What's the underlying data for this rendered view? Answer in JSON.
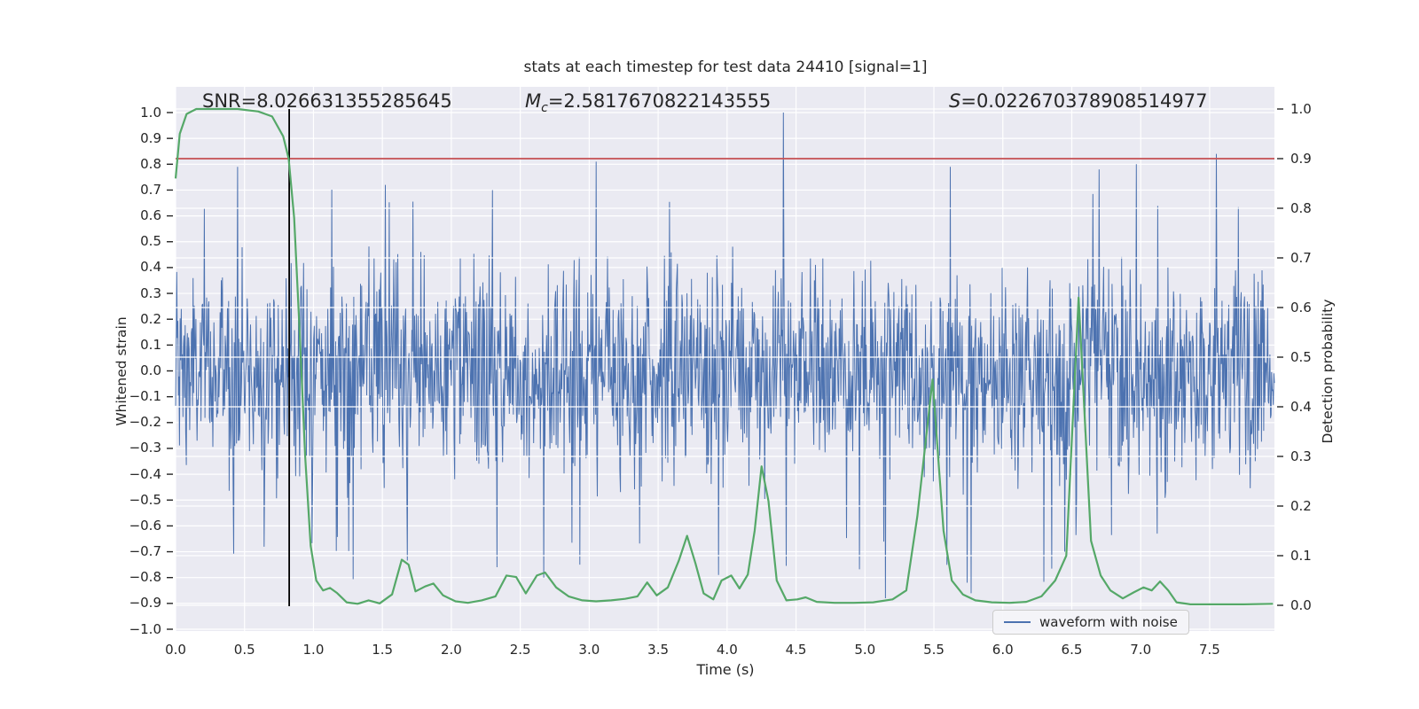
{
  "title": "stats at each timestep for test data 24410 [signal=1]",
  "annotations": {
    "snr": "SNR=8.026631355285645",
    "mc_symbol": "M",
    "mc_subscript": "c",
    "mc_value": "=2.5817670822143555",
    "s_symbol": "S",
    "s_value": "=0.022670378908514977"
  },
  "axes": {
    "x": {
      "label": "Time (s)",
      "tick_labels": [
        "0.0",
        "0.5",
        "1.0",
        "1.5",
        "2.0",
        "2.5",
        "3.0",
        "3.5",
        "4.0",
        "4.5",
        "5.0",
        "5.5",
        "6.0",
        "6.5",
        "7.0",
        "7.5"
      ],
      "tick_values": [
        0,
        0.5,
        1,
        1.5,
        2,
        2.5,
        3,
        3.5,
        4,
        4.5,
        5,
        5.5,
        6,
        6.5,
        7,
        7.5
      ],
      "range": [
        0,
        7.97
      ]
    },
    "y_left": {
      "label": "Whitened strain",
      "tick_labels": [
        "1.0",
        "0.9",
        "0.8",
        "0.7",
        "0.6",
        "0.5",
        "0.4",
        "0.3",
        "0.2",
        "0.1",
        "0.0",
        "−0.1",
        "−0.2",
        "−0.3",
        "−0.4",
        "−0.5",
        "−0.6",
        "−0.7",
        "−0.8",
        "−0.9",
        "−1.0"
      ],
      "tick_values": [
        1,
        0.9,
        0.8,
        0.7,
        0.6,
        0.5,
        0.4,
        0.3,
        0.2,
        0.1,
        0,
        -0.1,
        -0.2,
        -0.3,
        -0.4,
        -0.5,
        -0.6,
        -0.7,
        -0.8,
        -0.9,
        -1
      ],
      "range": [
        -1.0,
        1.0
      ]
    },
    "y_right": {
      "label": "Detection probability",
      "tick_labels": [
        "1.0",
        "0.9",
        "0.8",
        "0.7",
        "0.6",
        "0.5",
        "0.4",
        "0.3",
        "0.2",
        "0.1",
        "0.0"
      ],
      "tick_values": [
        1,
        0.9,
        0.8,
        0.7,
        0.6,
        0.5,
        0.4,
        0.3,
        0.2,
        0.1,
        0
      ],
      "range": [
        0.0,
        1.0
      ]
    }
  },
  "legend": {
    "label": "waveform with noise"
  },
  "colors": {
    "waveform": "#4c72b0",
    "probability": "#55a868",
    "threshold": "#c44e52",
    "event_marker": "#000000",
    "plot_bg": "#eaeaf2",
    "grid": "#ffffff",
    "text": "#262626"
  },
  "chart_data": {
    "type": "line",
    "title": "stats at each timestep for test data 24410 [signal=1]",
    "xlabel": "Time (s)",
    "ylabel_left": "Whitened strain",
    "ylabel_right": "Detection probability",
    "xlim": [
      0,
      7.97
    ],
    "ylim_left": [
      -1.0,
      1.0
    ],
    "ylim_right": [
      0.0,
      1.0
    ],
    "grid": true,
    "legend_position": "lower right",
    "threshold_line": {
      "axis": "right",
      "value": 0.9
    },
    "event_line": {
      "time": 0.824
    },
    "series": [
      {
        "name": "waveform with noise",
        "axis": "left",
        "kind": "noise",
        "samples": 1950,
        "sigma": 0.205,
        "tail_gain": 1.25,
        "clip": 1.0,
        "seed": 1234,
        "spikes": [
          {
            "t": 4.41,
            "v": 1.0
          },
          {
            "t": 3.05,
            "v": 0.81
          },
          {
            "t": 7.55,
            "v": 0.84
          },
          {
            "t": 6.97,
            "v": 0.8
          },
          {
            "t": 6.7,
            "v": 0.78
          },
          {
            "t": 5.62,
            "v": 0.79
          },
          {
            "t": 0.45,
            "v": 0.79
          },
          {
            "t": 1.52,
            "v": 0.72
          },
          {
            "t": 2.3,
            "v": 0.7
          },
          {
            "t": 2.67,
            "v": -0.8
          },
          {
            "t": 2.93,
            "v": -0.75
          },
          {
            "t": 5.15,
            "v": -0.88
          },
          {
            "t": 6.45,
            "v": -0.7
          },
          {
            "t": 7.12,
            "v": -0.63
          },
          {
            "t": 2.33,
            "v": -0.76
          },
          {
            "t": 3.94,
            "v": -0.79
          },
          {
            "t": 5.74,
            "v": -0.82
          }
        ]
      },
      {
        "name": "detection probability",
        "axis": "right",
        "kind": "line",
        "points": [
          [
            0.0,
            0.86
          ],
          [
            0.03,
            0.95
          ],
          [
            0.08,
            0.99
          ],
          [
            0.15,
            1.0
          ],
          [
            0.3,
            1.0
          ],
          [
            0.45,
            1.0
          ],
          [
            0.6,
            0.995
          ],
          [
            0.7,
            0.985
          ],
          [
            0.78,
            0.945
          ],
          [
            0.82,
            0.9
          ],
          [
            0.86,
            0.78
          ],
          [
            0.9,
            0.55
          ],
          [
            0.94,
            0.3
          ],
          [
            0.98,
            0.12
          ],
          [
            1.02,
            0.05
          ],
          [
            1.07,
            0.03
          ],
          [
            1.12,
            0.035
          ],
          [
            1.17,
            0.025
          ],
          [
            1.24,
            0.006
          ],
          [
            1.32,
            0.003
          ],
          [
            1.4,
            0.01
          ],
          [
            1.48,
            0.004
          ],
          [
            1.57,
            0.022
          ],
          [
            1.64,
            0.092
          ],
          [
            1.69,
            0.082
          ],
          [
            1.74,
            0.028
          ],
          [
            1.81,
            0.038
          ],
          [
            1.87,
            0.044
          ],
          [
            1.94,
            0.02
          ],
          [
            2.03,
            0.008
          ],
          [
            2.12,
            0.005
          ],
          [
            2.22,
            0.01
          ],
          [
            2.32,
            0.018
          ],
          [
            2.4,
            0.06
          ],
          [
            2.47,
            0.057
          ],
          [
            2.54,
            0.024
          ],
          [
            2.62,
            0.06
          ],
          [
            2.68,
            0.066
          ],
          [
            2.76,
            0.036
          ],
          [
            2.85,
            0.018
          ],
          [
            2.95,
            0.01
          ],
          [
            3.05,
            0.008
          ],
          [
            3.16,
            0.01
          ],
          [
            3.26,
            0.013
          ],
          [
            3.35,
            0.018
          ],
          [
            3.42,
            0.046
          ],
          [
            3.49,
            0.02
          ],
          [
            3.57,
            0.036
          ],
          [
            3.65,
            0.09
          ],
          [
            3.71,
            0.14
          ],
          [
            3.77,
            0.085
          ],
          [
            3.83,
            0.024
          ],
          [
            3.9,
            0.012
          ],
          [
            3.96,
            0.05
          ],
          [
            4.03,
            0.06
          ],
          [
            4.09,
            0.034
          ],
          [
            4.15,
            0.062
          ],
          [
            4.2,
            0.15
          ],
          [
            4.25,
            0.28
          ],
          [
            4.3,
            0.21
          ],
          [
            4.36,
            0.05
          ],
          [
            4.43,
            0.01
          ],
          [
            4.51,
            0.012
          ],
          [
            4.57,
            0.016
          ],
          [
            4.65,
            0.007
          ],
          [
            4.78,
            0.005
          ],
          [
            4.92,
            0.005
          ],
          [
            5.06,
            0.006
          ],
          [
            5.2,
            0.012
          ],
          [
            5.3,
            0.03
          ],
          [
            5.38,
            0.18
          ],
          [
            5.49,
            0.455
          ],
          [
            5.57,
            0.15
          ],
          [
            5.63,
            0.05
          ],
          [
            5.71,
            0.022
          ],
          [
            5.8,
            0.01
          ],
          [
            5.92,
            0.006
          ],
          [
            6.05,
            0.005
          ],
          [
            6.17,
            0.007
          ],
          [
            6.28,
            0.018
          ],
          [
            6.38,
            0.05
          ],
          [
            6.46,
            0.1
          ],
          [
            6.55,
            0.62
          ],
          [
            6.64,
            0.13
          ],
          [
            6.71,
            0.06
          ],
          [
            6.78,
            0.03
          ],
          [
            6.87,
            0.014
          ],
          [
            6.95,
            0.026
          ],
          [
            7.02,
            0.036
          ],
          [
            7.08,
            0.03
          ],
          [
            7.14,
            0.048
          ],
          [
            7.2,
            0.03
          ],
          [
            7.26,
            0.006
          ],
          [
            7.36,
            0.002
          ],
          [
            7.55,
            0.002
          ],
          [
            7.75,
            0.002
          ],
          [
            7.96,
            0.003
          ]
        ]
      }
    ]
  }
}
